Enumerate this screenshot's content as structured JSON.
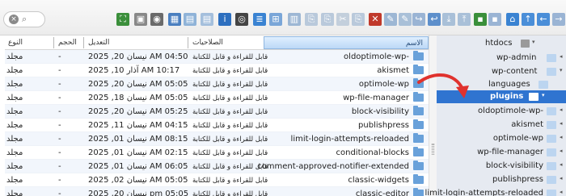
{
  "toolbar": {
    "search_clear": "×",
    "search_icon": "⌕",
    "buttons": [
      {
        "name": "fullscreen-icon",
        "color": "#3b8f3b",
        "glyph": "⛶"
      },
      {
        "name": "archive-icon",
        "color": "#888888",
        "glyph": "▣"
      },
      {
        "name": "view-icon",
        "color": "#6a6a6a",
        "glyph": "◉"
      },
      {
        "name": "grid-view-icon",
        "color": "#4a7fc0",
        "glyph": "▦"
      },
      {
        "name": "image-icon",
        "color": "#8fb3d8",
        "glyph": "▤"
      },
      {
        "name": "image-edit-icon",
        "color": "#a4bfdc",
        "glyph": "▤"
      },
      {
        "name": "info-icon",
        "color": "#2d6fbf",
        "glyph": "i"
      },
      {
        "name": "preview-icon",
        "color": "#444444",
        "glyph": "◎"
      },
      {
        "name": "list-view-icon",
        "color": "#3a83d2",
        "glyph": "≣"
      },
      {
        "name": "icon-view-icon",
        "color": "#7aa6d8",
        "glyph": "⊞"
      },
      {
        "name": "layout-icon",
        "color": "#9db7d4",
        "glyph": "▥"
      },
      {
        "name": "paste-icon",
        "color": "#b9c9db",
        "glyph": "⎘"
      },
      {
        "name": "copy-icon",
        "color": "#b9c9db",
        "glyph": "⎘"
      },
      {
        "name": "cut-icon",
        "color": "#c3cfdc",
        "glyph": "✂"
      },
      {
        "name": "duplicate-icon",
        "color": "#b9c9db",
        "glyph": "⎘"
      },
      {
        "name": "delete-icon",
        "color": "#c0392b",
        "glyph": "✕"
      },
      {
        "name": "rename-icon",
        "color": "#9db7d4",
        "glyph": "✎"
      },
      {
        "name": "edit-icon",
        "color": "#a9c0d8",
        "glyph": "✎"
      },
      {
        "name": "redo-icon",
        "color": "#9ab4d4",
        "glyph": "↪"
      },
      {
        "name": "undo-icon",
        "color": "#5d8fcb",
        "glyph": "↩"
      },
      {
        "name": "download-icon",
        "color": "#a9c0d8",
        "glyph": "⤓"
      },
      {
        "name": "upload-icon",
        "color": "#a9c0d8",
        "glyph": "⤒"
      },
      {
        "name": "save-icon",
        "color": "#3a8f3a",
        "glyph": "▪"
      },
      {
        "name": "save-alt-icon",
        "color": "#9ab4d4",
        "glyph": "▪"
      },
      {
        "name": "home-icon",
        "color": "#3a83d2",
        "glyph": "⌂"
      },
      {
        "name": "up-icon",
        "color": "#4a8ed8",
        "glyph": "↑"
      },
      {
        "name": "back-icon",
        "color": "#4a8ed8",
        "glyph": "←"
      },
      {
        "name": "forward-icon",
        "color": "#9ab4d4",
        "glyph": "→"
      }
    ]
  },
  "columns": {
    "name": "الاسم",
    "permissions": "الصلاحيات",
    "modified": "التعديل",
    "size": "الحجم",
    "type": "النوع"
  },
  "rows": [
    {
      "name": "oldoptimole-wp-",
      "perm": "قابل للقراءة و قابل للكتابة",
      "date": "نيسان 20, 2025 AM 04:50",
      "size": "-",
      "type": "مجلد"
    },
    {
      "name": "akismet",
      "perm": "قابل للقراءة و قابل للكتابة",
      "date": "آذار 10, 2025 AM 10:17",
      "size": "-",
      "type": "مجلد"
    },
    {
      "name": "optimole-wp",
      "perm": "قابل للقراءة و قابل للكتابة",
      "date": "نيسان 20, 2025 AM 05:05",
      "size": "-",
      "type": "مجلد"
    },
    {
      "name": "wp-file-manager",
      "perm": "قابل للقراءة و قابل للكتابة",
      "date": "نيسان 18, 2025 AM 05:05",
      "size": "-",
      "type": "مجلد"
    },
    {
      "name": "block-visibility",
      "perm": "قابل للقراءة و قابل للكتابة",
      "date": "نيسان 20, 2025 AM 05:25",
      "size": "-",
      "type": "مجلد"
    },
    {
      "name": "publishpress",
      "perm": "قابل للقراءة و قابل للكتابة",
      "date": "نيسان 11, 2025 AM 04:15",
      "size": "-",
      "type": "مجلد"
    },
    {
      "name": "limit-login-attempts-reloaded",
      "perm": "قابل للقراءة و قابل للكتابة",
      "date": "نيسان 01, 2025 AM 08:15",
      "size": "-",
      "type": "مجلد"
    },
    {
      "name": "conditional-blocks",
      "perm": "قابل للقراءة و قابل للكتابة",
      "date": "نيسان 01, 2025 AM 02:15",
      "size": "-",
      "type": "مجلد"
    },
    {
      "name": "comment-approved-notifier-extended",
      "perm": "قابل للقراءة و قابل للكتابة",
      "date": "نيسان 01, 2025 AM 06:05",
      "size": "-",
      "type": "مجلد"
    },
    {
      "name": "classic-widgets",
      "perm": "قابل للقراءة و قابل للكتابة",
      "date": "نيسان 02, 2025 AM 05:05",
      "size": "-",
      "type": "مجلد"
    },
    {
      "name": "classic-editor",
      "perm": "قابل للقراءة و قابل للكتابة",
      "date": "نيسان 20, 2025 pm 05:05",
      "size": "-",
      "type": "مجلد"
    }
  ],
  "tree": {
    "root": "htdocs",
    "wp_admin": "wp-admin",
    "wp_content": "wp-content",
    "languages": "languages",
    "plugins": "plugins",
    "children": [
      "oldoptimole-wp-",
      "akismet",
      "optimole-wp",
      "wp-file-manager",
      "block-visibility",
      "publishpress",
      "limit-login-attempts-reloaded"
    ]
  },
  "colors": {
    "selection": "#2f74d0",
    "folder": "#69a1da",
    "annotation_arrow": "#e0322e"
  }
}
